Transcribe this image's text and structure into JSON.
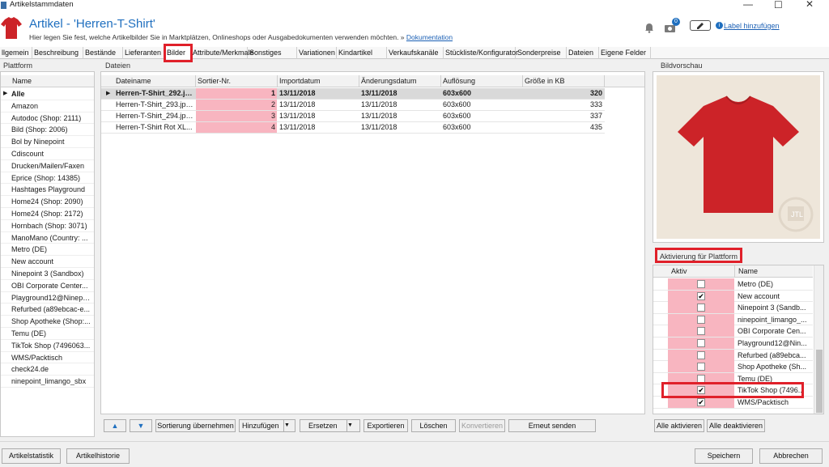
{
  "window": {
    "title": "Artikelstammdaten"
  },
  "header": {
    "title": "Artikel - 'Herren-T-Shirt'",
    "subtitle": "Hier legen Sie fest, welche Artikelbilder Sie in Marktplätzen, Onlineshops oder Ausgabedokumenten verwenden möchten. »",
    "doc_link": "Dokumentation",
    "camera_badge": "0",
    "label_link": "Label hinzufügen"
  },
  "tabs": [
    "llgemein",
    "Beschreibung",
    "Bestände",
    "Lieferanten",
    "Bilder",
    "Attribute/Merkmale",
    "Sonstiges",
    "Variationen",
    "Kindartikel",
    "Verkaufskanäle",
    "Stückliste/Konfigurator",
    "Sonderpreise",
    "Dateien",
    "Eigene Felder"
  ],
  "platform": {
    "title": "Plattform",
    "header": "Name",
    "items": [
      "Alle",
      "Amazon",
      "Autodoc (Shop: 2111)",
      "Bild (Shop: 2006)",
      "Bol by Ninepoint",
      "Cdiscount",
      "Drucken/Mailen/Faxen",
      "Eprice (Shop: 14385)",
      "Hashtages Playground",
      "Home24 (Shop: 2090)",
      "Home24 (Shop: 2172)",
      "Hornbach (Shop: 3071)",
      "ManoMano (Country: ...",
      "Metro (DE)",
      "New account",
      "Ninepoint 3 (Sandbox)",
      "OBI Corporate Center...",
      "Playground12@Ninepo...",
      "Refurbed (a89ebcac-e...",
      "Shop Apotheke (Shop:...",
      "Temu (DE)",
      "TikTok Shop (7496063...",
      "WMS/Packtisch",
      "check24.de",
      "ninepoint_limango_sbx"
    ]
  },
  "files": {
    "title": "Dateien",
    "columns": [
      "Dateiname",
      "Sortier-Nr.",
      "Importdatum",
      "Änderungsdatum",
      "Auflösung",
      "Größe in KB"
    ],
    "rows": [
      [
        "Herren-T-Shirt_292.jp...",
        "1",
        "13/11/2018",
        "13/11/2018",
        "603x600",
        "320"
      ],
      [
        "Herren-T-Shirt_293.jpeg",
        "2",
        "13/11/2018",
        "13/11/2018",
        "603x600",
        "333"
      ],
      [
        "Herren-T-Shirt_294.jpeg",
        "3",
        "13/11/2018",
        "13/11/2018",
        "603x600",
        "337"
      ],
      [
        "Herren-T-Shirt Rot XL...",
        "4",
        "13/11/2018",
        "13/11/2018",
        "603x600",
        "435"
      ]
    ],
    "buttons": {
      "up": "▲",
      "down": "▼",
      "sort": "Sortierung übernehmen",
      "add": "Hinzufügen",
      "replace": "Ersetzen",
      "export": "Exportieren",
      "delete": "Löschen",
      "convert": "Konvertieren",
      "resend": "Erneut senden"
    }
  },
  "preview": {
    "title": "Bildvorschau",
    "watermark": "JTL"
  },
  "activation": {
    "title": "Aktivierung für Plattform",
    "col_active": "Aktiv",
    "col_name": "Name",
    "rows": [
      {
        "name": "Metro (DE)",
        "checked": false
      },
      {
        "name": "New account",
        "checked": true
      },
      {
        "name": "Ninepoint 3 (Sandb...",
        "checked": false
      },
      {
        "name": "ninepoint_limango_...",
        "checked": false
      },
      {
        "name": "OBI Corporate Cen...",
        "checked": false
      },
      {
        "name": "Playground12@Nin...",
        "checked": false
      },
      {
        "name": "Refurbed (a89ebca...",
        "checked": false
      },
      {
        "name": "Shop Apotheke (Sh...",
        "checked": false
      },
      {
        "name": "Temu (DE)",
        "checked": false
      },
      {
        "name": "TikTok Shop (7496...",
        "checked": true
      },
      {
        "name": "WMS/Packtisch",
        "checked": true
      }
    ],
    "btn_all_on": "Alle aktivieren",
    "btn_all_off": "Alle deaktivieren"
  },
  "footer": {
    "stats": "Artikelstatistik",
    "history": "Artikelhistorie",
    "save": "Speichern",
    "cancel": "Abbrechen"
  },
  "colors": {
    "accent": "#1f6fbf",
    "highlight": "#e0202a",
    "sort_cell": "#f8b5c0",
    "shirt": "#cc2328"
  }
}
